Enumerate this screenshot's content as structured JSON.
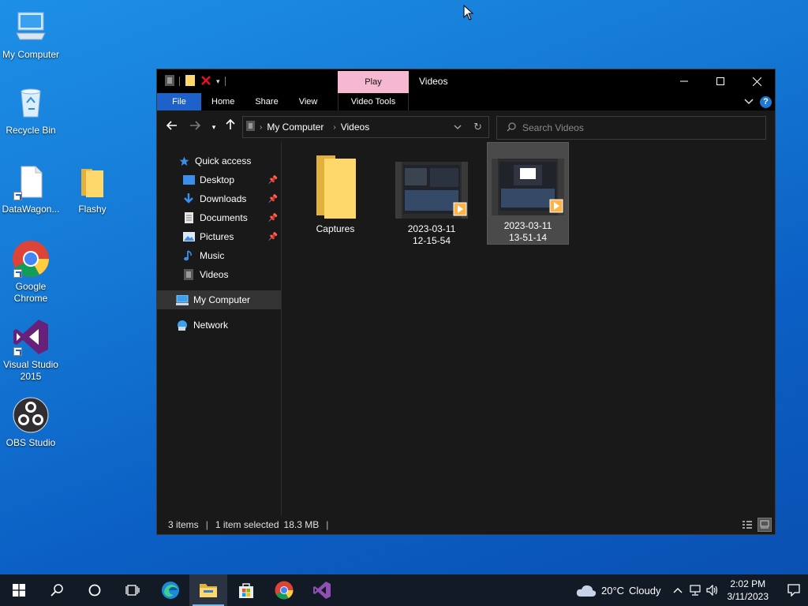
{
  "desktop": {
    "icons": [
      {
        "label": "My Computer",
        "icon": "computer-icon"
      },
      {
        "label": "Recycle Bin",
        "icon": "recycle-bin-icon"
      },
      {
        "label": "DataWagon...",
        "icon": "file-shortcut-icon"
      },
      {
        "label": "Flashy",
        "icon": "folder-icon"
      },
      {
        "label": "Google Chrome",
        "icon": "chrome-icon"
      },
      {
        "label": "Visual Studio 2015",
        "icon": "visual-studio-icon"
      },
      {
        "label": "OBS Studio",
        "icon": "obs-icon"
      }
    ]
  },
  "window": {
    "title": "Videos",
    "context_tab": "Play",
    "ribbon_tabs": [
      "File",
      "Home",
      "Share",
      "View",
      "Video Tools"
    ],
    "address": {
      "root": "My Computer",
      "current": "Videos"
    },
    "search": {
      "placeholder": "Search Videos",
      "value": ""
    },
    "nav": [
      {
        "label": "Quick access",
        "icon": "star-icon",
        "pinned": false
      },
      {
        "label": "Desktop",
        "icon": "desktop-icon",
        "pinned": true
      },
      {
        "label": "Downloads",
        "icon": "download-icon",
        "pinned": true
      },
      {
        "label": "Documents",
        "icon": "document-icon",
        "pinned": true
      },
      {
        "label": "Pictures",
        "icon": "picture-icon",
        "pinned": true
      },
      {
        "label": "Music",
        "icon": "music-icon",
        "pinned": false
      },
      {
        "label": "Videos",
        "icon": "video-icon",
        "pinned": false
      },
      {
        "label": "My Computer",
        "icon": "computer-icon",
        "pinned": false,
        "selected": true
      },
      {
        "label": "Network",
        "icon": "network-icon",
        "pinned": false
      }
    ],
    "files": [
      {
        "name": "Captures",
        "type": "folder",
        "selected": false
      },
      {
        "name_line1": "2023-03-11",
        "name_line2": "12-15-54",
        "type": "video",
        "selected": false
      },
      {
        "name_line1": "2023-03-11",
        "name_line2": "13-51-14",
        "type": "video",
        "selected": true
      }
    ],
    "status": {
      "count": "3 items",
      "selection": "1 item selected",
      "size": "18.3 MB"
    }
  },
  "taskbar": {
    "weather": {
      "temp": "20°C",
      "condition": "Cloudy"
    },
    "time": "2:02 PM",
    "date": "3/11/2023"
  },
  "colors": {
    "accent": "#1e62c9",
    "context_tab": "#f6b8d1",
    "window_bg": "#191919",
    "taskbar_bg": "#121a26"
  }
}
